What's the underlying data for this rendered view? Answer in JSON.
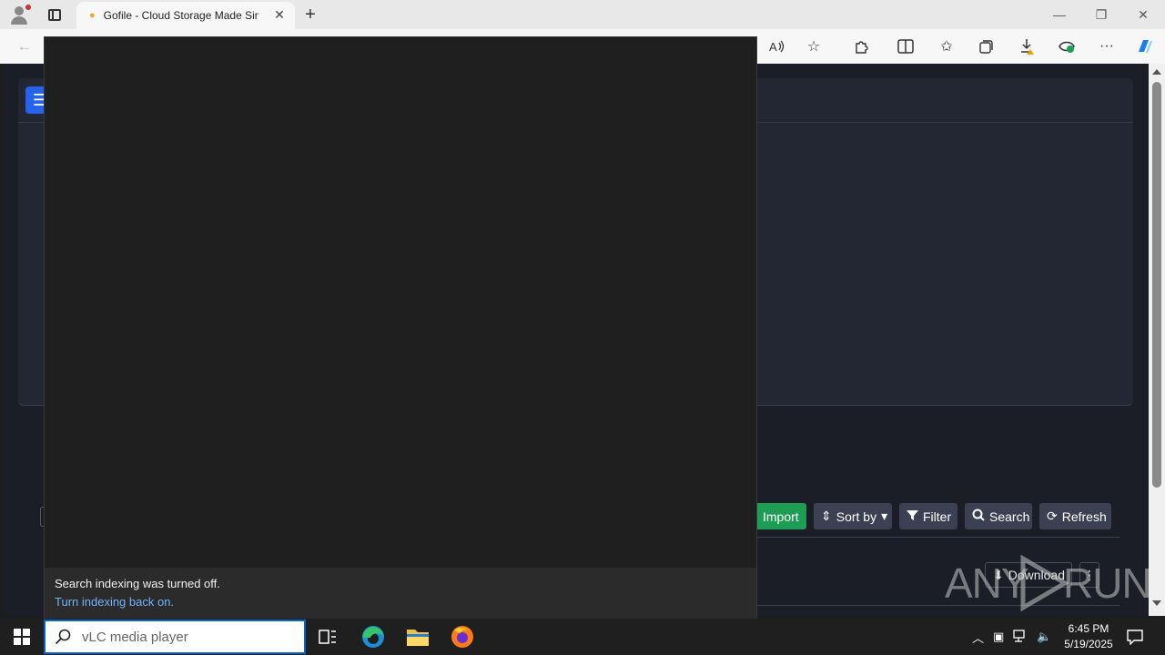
{
  "browser": {
    "tab_title": "Gofile - Cloud Storage Made Simple",
    "tab_close": "✕",
    "new_tab": "+",
    "window_controls": {
      "minimize": "—",
      "maximize": "❐",
      "close": "✕"
    }
  },
  "page": {
    "toolbar": {
      "import_label": "Import",
      "sort_label": "Sort by",
      "filter_label": "Filter",
      "search_label": "Search",
      "refresh_label": "Refresh"
    },
    "row": {
      "download_label": "Download"
    }
  },
  "search_overlay": {
    "indexing_message": "Search indexing was turned off.",
    "indexing_link": "Turn indexing back on."
  },
  "watermark": {
    "left": "ANY",
    "right": "RUN"
  },
  "taskbar": {
    "search_text": "vLC media player",
    "time": "6:45 PM",
    "date": "5/19/2025"
  },
  "colors": {
    "accent": "#2563eb",
    "import_green": "#1e9e55",
    "link_blue": "#6fb3ff",
    "page_bg": "#1b1e27"
  }
}
